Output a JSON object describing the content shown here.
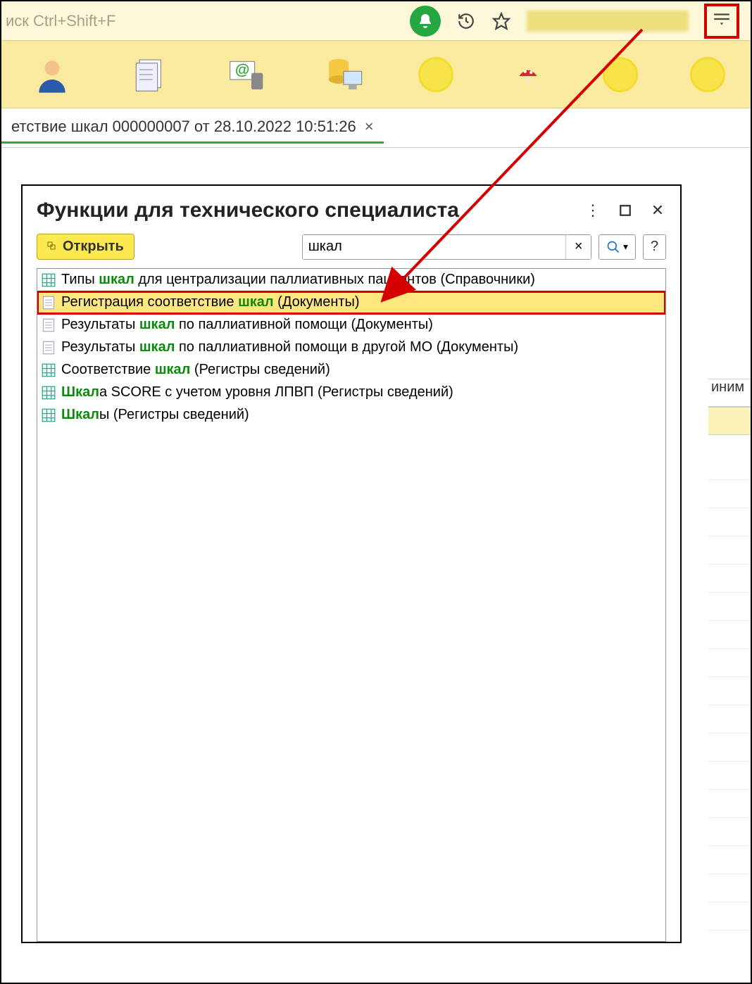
{
  "search_hint": "иск Ctrl+Shift+F",
  "tab_title": "етствие шкал 000000007 от 28.10.2022 10:51:26",
  "dialog": {
    "title": "Функции для технического специалиста",
    "open_label": "Открыть",
    "search_value": "шкал",
    "help_label": "?"
  },
  "list": [
    {
      "icon": "grid",
      "pre": "Типы ",
      "hl": "шкал",
      "post": " для централизации паллиативных пациентов (Справочники)",
      "selected": false
    },
    {
      "icon": "doc",
      "pre": "Регистрация соответствие ",
      "hl": "шкал",
      "post": " (Документы)",
      "selected": true
    },
    {
      "icon": "doc",
      "pre": "Результаты ",
      "hl": "шкал",
      "post": " по паллиативной помощи (Документы)",
      "selected": false
    },
    {
      "icon": "doc",
      "pre": "Результаты ",
      "hl": "шкал",
      "post": " по паллиативной помощи в другой МО (Документы)",
      "selected": false
    },
    {
      "icon": "grid",
      "pre": "Соответствие ",
      "hl": "шкал",
      "post": " (Регистры сведений)",
      "selected": false
    },
    {
      "icon": "grid",
      "pre": "",
      "hl": "Шкал",
      "post": "а SCORE с учетом уровня ЛПВП (Регистры сведений)",
      "selected": false
    },
    {
      "icon": "grid",
      "pre": "",
      "hl": "Шкал",
      "post": "ы (Регистры сведений)",
      "selected": false
    }
  ],
  "side": {
    "header": "иним",
    "row1": ""
  }
}
